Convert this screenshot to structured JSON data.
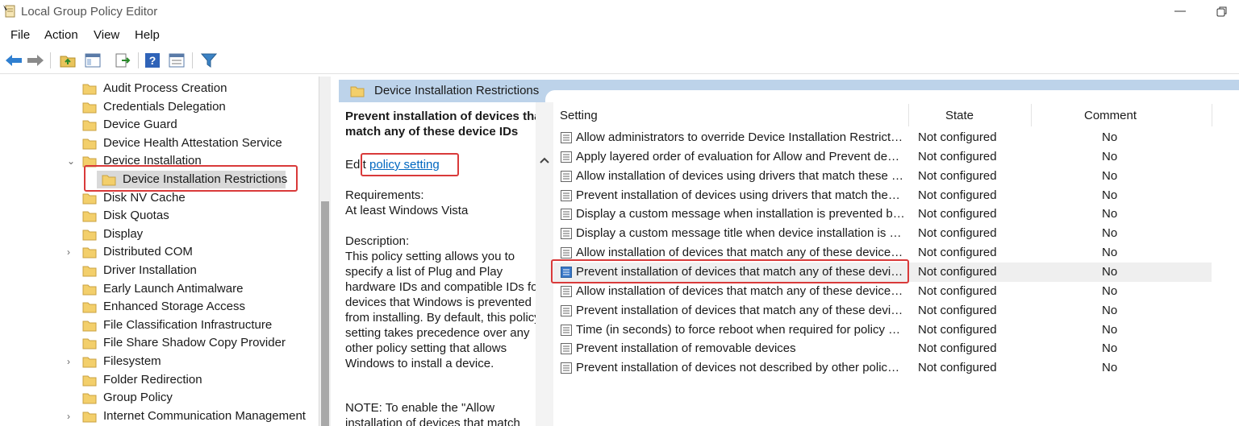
{
  "window": {
    "title": "Local Group Policy Editor"
  },
  "menu": [
    "File",
    "Action",
    "View",
    "Help"
  ],
  "tree": {
    "items": [
      {
        "label": "Audit Process Creation",
        "expander": ""
      },
      {
        "label": "Credentials Delegation",
        "expander": ""
      },
      {
        "label": "Device Guard",
        "expander": ""
      },
      {
        "label": "Device Health Attestation Service",
        "expander": ""
      },
      {
        "label": "Device Installation",
        "expander": "expanded"
      },
      {
        "label": "Device Installation Restrictions",
        "expander": "",
        "selected": true,
        "indent": 1
      },
      {
        "label": "Disk NV Cache",
        "expander": ""
      },
      {
        "label": "Disk Quotas",
        "expander": ""
      },
      {
        "label": "Display",
        "expander": ""
      },
      {
        "label": "Distributed COM",
        "expander": "collapsed"
      },
      {
        "label": "Driver Installation",
        "expander": ""
      },
      {
        "label": "Early Launch Antimalware",
        "expander": ""
      },
      {
        "label": "Enhanced Storage Access",
        "expander": ""
      },
      {
        "label": "File Classification Infrastructure",
        "expander": ""
      },
      {
        "label": "File Share Shadow Copy Provider",
        "expander": ""
      },
      {
        "label": "Filesystem",
        "expander": "collapsed"
      },
      {
        "label": "Folder Redirection",
        "expander": ""
      },
      {
        "label": "Group Policy",
        "expander": ""
      },
      {
        "label": "Internet Communication Management",
        "expander": "collapsed"
      }
    ]
  },
  "header": {
    "title": "Device Installation Restrictions"
  },
  "description": {
    "heading": "Prevent installation of devices that match any of these device IDs",
    "edit_prefix": "Edit ",
    "edit_link": "policy setting ",
    "requirements_label": "Requirements:",
    "requirements_value": "At least Windows Vista",
    "description_label": "Description:",
    "description_text": "This policy setting allows you to specify a list of Plug and Play hardware IDs and compatible IDs for devices that Windows is prevented from installing. By default, this policy setting takes precedence over any other policy setting that allows Windows to install a device.",
    "note_text": "NOTE: To enable the \"Allow installation of devices that match"
  },
  "grid": {
    "columns": {
      "setting": "Setting",
      "state": "State",
      "comment": "Comment"
    },
    "rows": [
      {
        "setting": "Allow administrators to override Device Installation Restriction policies",
        "state": "Not configured",
        "comment": "No"
      },
      {
        "setting": "Apply layered order of evaluation for Allow and Prevent device installation policies",
        "state": "Not configured",
        "comment": "No"
      },
      {
        "setting": "Allow installation of devices using drivers that match these driver setup classes",
        "state": "Not configured",
        "comment": "No"
      },
      {
        "setting": "Prevent installation of devices using drivers that match these device setup classes",
        "state": "Not configured",
        "comment": "No"
      },
      {
        "setting": "Display a custom message when installation is prevented by a policy setting",
        "state": "Not configured",
        "comment": "No"
      },
      {
        "setting": "Display a custom message title when device installation is prevented",
        "state": "Not configured",
        "comment": "No"
      },
      {
        "setting": "Allow installation of devices that match any of these device IDs",
        "state": "Not configured",
        "comment": "No"
      },
      {
        "setting": "Prevent installation of devices that match any of these device IDs",
        "state": "Not configured",
        "comment": "No",
        "selected": true
      },
      {
        "setting": "Allow installation of devices that match any of these device instance IDs",
        "state": "Not configured",
        "comment": "No"
      },
      {
        "setting": "Prevent installation of devices that match any of these device instance IDs",
        "state": "Not configured",
        "comment": "No"
      },
      {
        "setting": "Time (in seconds) to force reboot when required for policy changes to take effect",
        "state": "Not configured",
        "comment": "No"
      },
      {
        "setting": "Prevent installation of removable devices",
        "state": "Not configured",
        "comment": "No"
      },
      {
        "setting": "Prevent installation of devices not described by other policy settings",
        "state": "Not configured",
        "comment": "No"
      }
    ]
  },
  "icons": {
    "app": "policy-editor-icon",
    "toolbar": [
      "back-arrow-icon",
      "forward-arrow-icon",
      "up-folder-icon",
      "show-hide-tree-icon",
      "export-list-icon",
      "help-icon",
      "properties-icon",
      "filter-icon"
    ],
    "folder": "folder-icon",
    "policy": "policy-setting-icon"
  },
  "colors": {
    "accent_highlight": "#d93a3a",
    "header_band": "#bdd3ea",
    "link": "#0067c0"
  }
}
